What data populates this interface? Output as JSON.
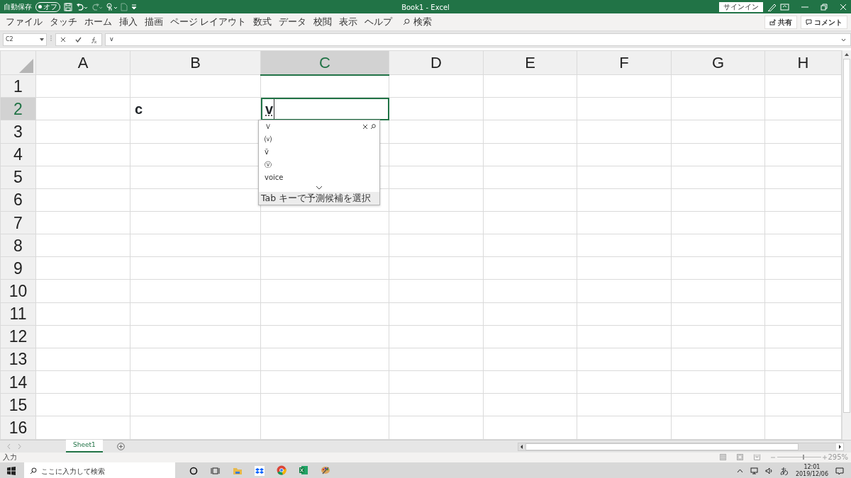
{
  "title_bar": {
    "autosave_label": "自動保存",
    "autosave_toggle": {
      "label": "オフ",
      "on": false
    },
    "title": "Book1  -  Excel",
    "signin": "サインイン"
  },
  "ribbon": {
    "tabs": [
      "ファイル",
      "タッチ",
      "ホーム",
      "挿入",
      "描画",
      "ページ レイアウト",
      "数式",
      "データ",
      "校閲",
      "表示",
      "ヘルプ"
    ],
    "search_label": "検索",
    "share": "共有",
    "comment": "コメント"
  },
  "formula_bar": {
    "name_box": "C2",
    "value": "v"
  },
  "sheet": {
    "columns": [
      {
        "label": "A",
        "selected": false
      },
      {
        "label": "B",
        "selected": false
      },
      {
        "label": "C",
        "selected": true
      },
      {
        "label": "D",
        "selected": false
      },
      {
        "label": "E",
        "selected": false
      },
      {
        "label": "F",
        "selected": false
      },
      {
        "label": "G",
        "selected": false
      },
      {
        "label": "H",
        "selected": false
      }
    ],
    "rows": [
      {
        "label": "1",
        "selected": false
      },
      {
        "label": "2",
        "selected": true,
        "cells": [
          {},
          {
            "text": "c"
          },
          {
            "text": "v",
            "editing": true
          },
          {},
          {},
          {},
          {},
          {}
        ]
      },
      {
        "label": "3",
        "selected": false
      },
      {
        "label": "4",
        "selected": false
      },
      {
        "label": "5",
        "selected": false
      },
      {
        "label": "6",
        "selected": false
      },
      {
        "label": "7",
        "selected": false
      },
      {
        "label": "8",
        "selected": false
      },
      {
        "label": "9",
        "selected": false
      },
      {
        "label": "10",
        "selected": false
      },
      {
        "label": "11",
        "selected": false
      },
      {
        "label": "12",
        "selected": false
      },
      {
        "label": "13",
        "selected": false
      },
      {
        "label": "14",
        "selected": false
      },
      {
        "label": "15",
        "selected": false
      },
      {
        "label": "16",
        "selected": false
      }
    ]
  },
  "ime_candidates": {
    "items": [
      "Ｖ",
      "⒱",
      "ṽ",
      "ⓥ",
      "voice"
    ],
    "footer": "Tab キーで予測候補を選択"
  },
  "sheet_tabs": [
    {
      "label": "Sheet1",
      "selected": true
    }
  ],
  "status_bar": {
    "mode": "入力",
    "zoom_slider": {
      "level": 0.6
    },
    "zoom": "295%"
  },
  "taskbar": {
    "search_placeholder": "ここに入力して検索",
    "apps": [
      {
        "kind": "cortana",
        "running": false
      },
      {
        "kind": "taskview",
        "running": false
      },
      {
        "kind": "explorer",
        "running": false
      },
      {
        "kind": "dropbox",
        "running": false
      },
      {
        "kind": "chrome",
        "running": true
      },
      {
        "kind": "excel",
        "running": true
      },
      {
        "kind": "paint",
        "running": true
      }
    ],
    "ime": "あ",
    "time": "12:01",
    "date": "2019/12/06"
  }
}
